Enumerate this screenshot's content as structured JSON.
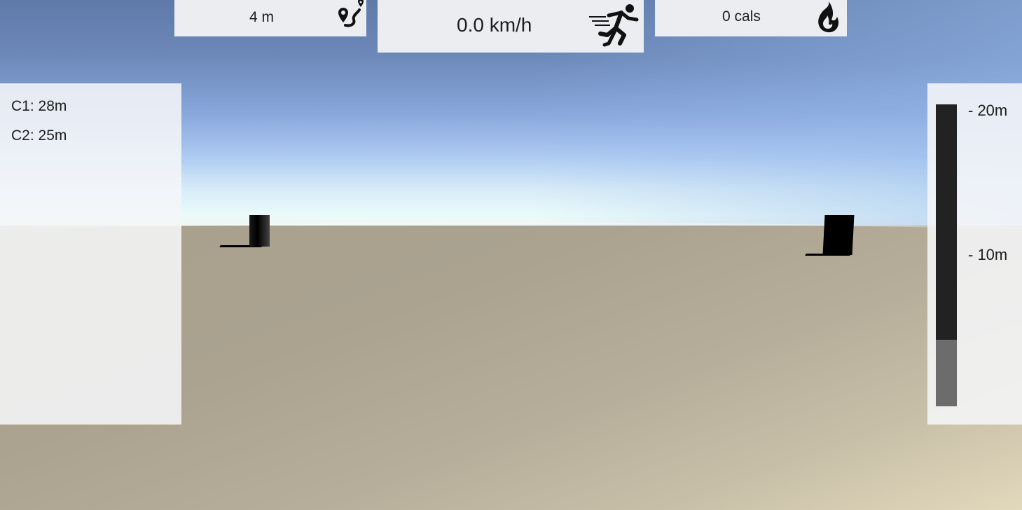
{
  "hud": {
    "distance": {
      "value": "4 m",
      "icon": "route-pin-icon"
    },
    "speed": {
      "value": "0.0 km/h",
      "icon": "running-person-icon"
    },
    "calories": {
      "value": "0 cals",
      "icon": "flame-icon"
    }
  },
  "checkpoints": {
    "items": [
      {
        "label": "C1: 28m"
      },
      {
        "label": "C2: 25m"
      }
    ]
  },
  "altitude_gauge": {
    "ticks": [
      {
        "label": "- 20m"
      },
      {
        "label": "- 10m"
      }
    ],
    "fill_fraction": 0.22,
    "bar_color": "#222222",
    "fill_color": "#6c6c6c"
  },
  "scene": {
    "sky_top_color": "#5f7aa8",
    "ground_color": "#aba390",
    "pillar_color": "#000000"
  }
}
